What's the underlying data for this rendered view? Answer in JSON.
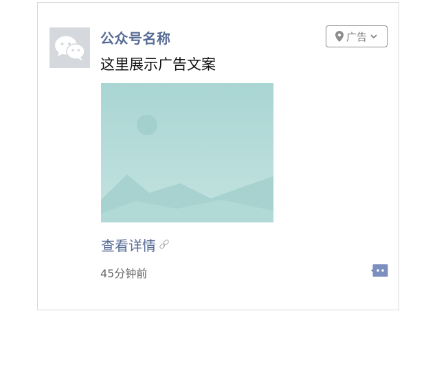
{
  "post": {
    "account_name": "公众号名称",
    "ad_text": "这里展示广告文案",
    "ad_tag_label": "广告",
    "detail_link_label": "查看详情",
    "time_ago": "45分钟前"
  },
  "icons": {
    "avatar": "wechat-logo-icon",
    "ad_tag_location": "location-pin-icon",
    "ad_tag_dropdown": "chevron-down-icon",
    "detail_link": "link-icon",
    "comment": "comment-action-icon"
  },
  "colors": {
    "link_blue": "#576b95",
    "image_teal": "#b4dcd9",
    "comment_button": "#7d8fbf"
  }
}
